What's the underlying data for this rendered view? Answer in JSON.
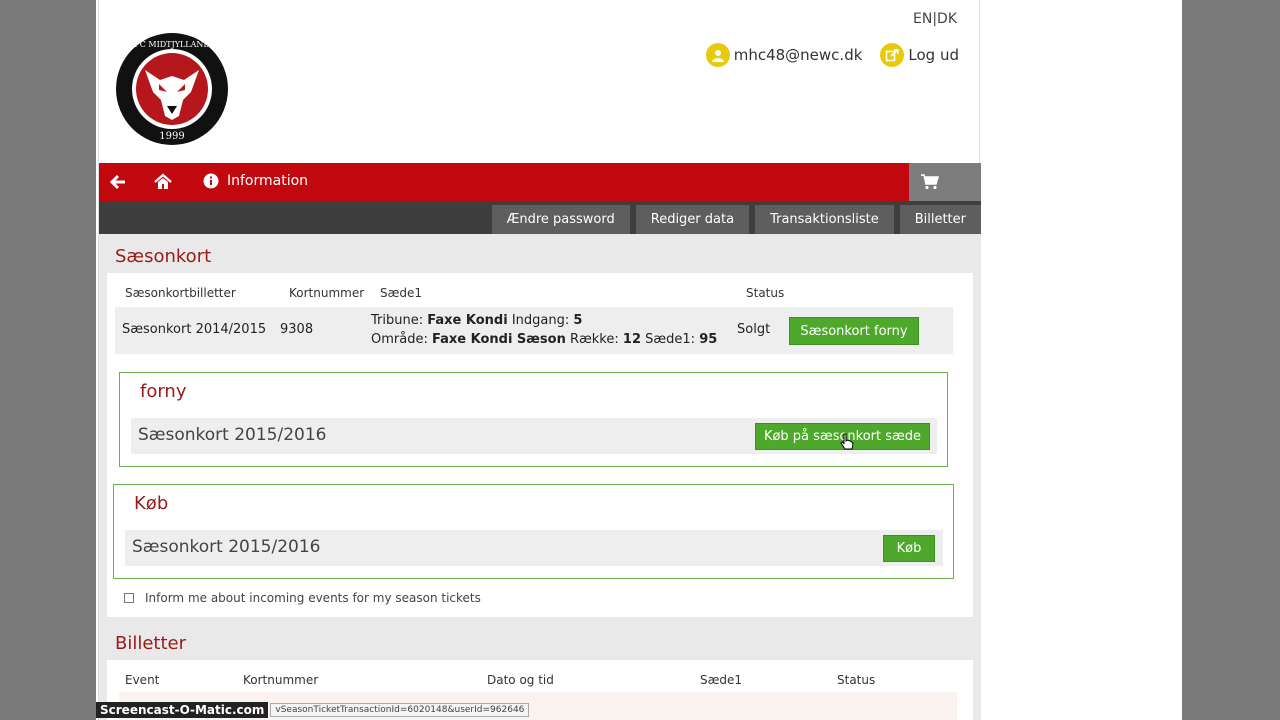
{
  "header": {
    "lang": "EN|DK",
    "logo_text_top": "FC MIDTJYLLAND",
    "logo_text_bottom": "1999",
    "user_email": "mhc48@newc.dk",
    "logout_label": "Log ud"
  },
  "nav": {
    "info_label": "Information",
    "tabs": [
      {
        "label": "Ændre password"
      },
      {
        "label": "Rediger data"
      },
      {
        "label": "Transaktionsliste"
      },
      {
        "label": "Billetter"
      }
    ]
  },
  "saesonkort": {
    "title": "Sæsonkort",
    "columns": [
      "Sæsonkortbilletter",
      "Kortnummer",
      "Sæde1",
      "Status"
    ],
    "row": {
      "name": "Sæsonkort 2014/2015",
      "number": "9308",
      "tribune_label": "Tribune:",
      "tribune_value": "Faxe Kondi",
      "indgang_label": "Indgang:",
      "indgang_value": "5",
      "omraade_label": "Område:",
      "omraade_value": "Faxe Kondi Sæson",
      "raekke_label": "Række:",
      "raekke_value": "12",
      "saede_label": "Sæde1:",
      "saede_value": "95",
      "status": "Solgt",
      "button": "Sæsonkort forny"
    }
  },
  "forny": {
    "title": "forny",
    "item": "Sæsonkort 2015/2016",
    "button": "Køb på sæsonkort sæde"
  },
  "koeb": {
    "title": "Køb",
    "item": "Sæsonkort 2015/2016",
    "button": "Køb"
  },
  "inform_label": "Inform me about incoming events for my season tickets",
  "billetter": {
    "title": "Billetter",
    "columns": [
      "Event",
      "Kortnummer",
      "Dato og tid",
      "Sæde1",
      "Status"
    ]
  },
  "statusbar": {
    "watermark": "Screencast-O-Matic.com",
    "url": "vSeasonTicketTransactionId=6020148&userId=962646"
  },
  "colors": {
    "brand_red": "#c0080e",
    "button_green": "#4ea82c",
    "icon_yellow": "#e8c90c"
  }
}
